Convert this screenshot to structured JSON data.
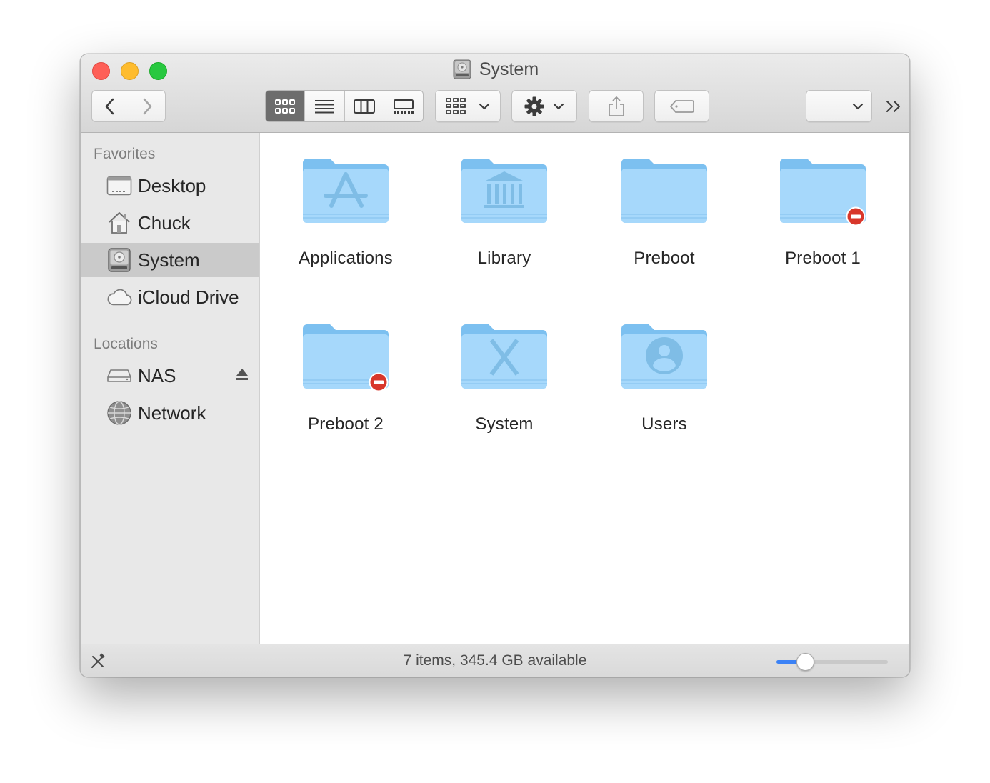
{
  "window": {
    "title": "System",
    "title_icon": "hard-drive-icon"
  },
  "toolbar": {
    "back_icon": "chevron-left-icon",
    "forward_icon": "chevron-right-icon",
    "views": [
      "icon-view-icon",
      "list-view-icon",
      "column-view-icon",
      "gallery-view-icon"
    ],
    "active_view": "icon",
    "group_icon": "group-by-icon",
    "action_icon": "gear-icon",
    "share_icon": "share-icon",
    "tag_icon": "tag-icon",
    "more_icon": "double-chevron-right-icon"
  },
  "sidebar": {
    "favorites_heading": "Favorites",
    "favorites": [
      {
        "label": "Desktop",
        "icon": "desktop-icon"
      },
      {
        "label": "Chuck",
        "icon": "home-icon"
      },
      {
        "label": "System",
        "icon": "hard-drive-icon",
        "selected": true
      },
      {
        "label": "iCloud Drive",
        "icon": "cloud-icon"
      }
    ],
    "locations_heading": "Locations",
    "locations": [
      {
        "label": "NAS",
        "icon": "network-drive-icon",
        "eject": true
      },
      {
        "label": "Network",
        "icon": "globe-icon"
      }
    ]
  },
  "content": {
    "items": [
      {
        "label": "Applications",
        "icon": "applications-folder-icon"
      },
      {
        "label": "Library",
        "icon": "library-folder-icon"
      },
      {
        "label": "Preboot",
        "icon": "folder-icon"
      },
      {
        "label": "Preboot 1",
        "icon": "folder-no-access-icon"
      },
      {
        "label": "Preboot 2",
        "icon": "folder-no-access-icon"
      },
      {
        "label": "System",
        "icon": "system-folder-icon"
      },
      {
        "label": "Users",
        "icon": "users-folder-icon"
      }
    ]
  },
  "status": {
    "text": "7 items, 345.4 GB available",
    "icon_size_fraction": 0.26
  },
  "colors": {
    "folder_light": "#a6d8fb",
    "folder_dark": "#7cc0f0",
    "selected_sidebar": "#cacaca",
    "close": "#fe5f57",
    "minimize": "#febc2e",
    "zoom": "#28c840",
    "slider_accent": "#3b82f6"
  }
}
